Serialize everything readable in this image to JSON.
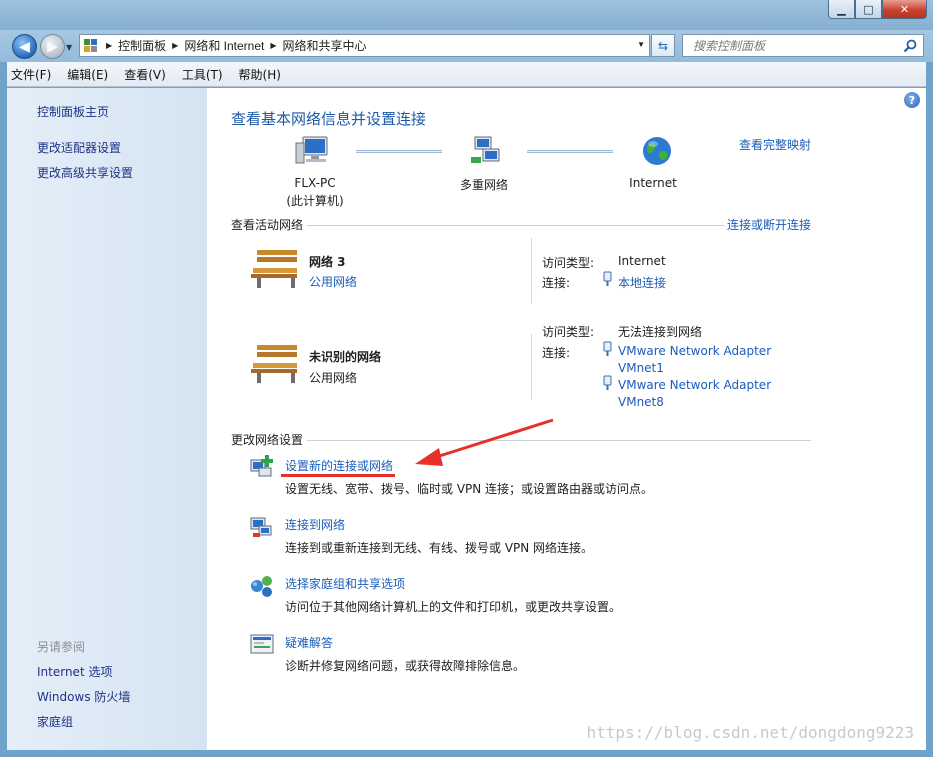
{
  "window": {
    "minimize_glyph": "▁",
    "maximize_glyph": "□",
    "close_glyph": "✕"
  },
  "address": {
    "crumbs": [
      "控制面板",
      "网络和 Internet",
      "网络和共享中心"
    ]
  },
  "search": {
    "placeholder": "搜索控制面板"
  },
  "menu": [
    "文件(F)",
    "编辑(E)",
    "查看(V)",
    "工具(T)",
    "帮助(H)"
  ],
  "sidebar": {
    "home": "控制面板主页",
    "adapter": "更改适配器设置",
    "sharing": "更改高级共享设置",
    "see_also": "另请参阅",
    "internet_options": "Internet 选项",
    "firewall": "Windows 防火墙",
    "homegroup": "家庭组"
  },
  "main": {
    "title": "查看基本网络信息并设置连接",
    "full_map": "查看完整映射",
    "map": {
      "pc_name": "FLX-PC",
      "pc_sub": "(此计算机)",
      "multi": "多重网络",
      "internet": "Internet"
    },
    "active_header": "查看活动网络",
    "connect_disconnect": "连接或断开连接",
    "net1": {
      "name": "网络  3",
      "type": "公用网络",
      "access_label": "访问类型:",
      "access_value": "Internet",
      "conn_label": "连接:",
      "conn_value": "本地连接"
    },
    "net2": {
      "name": "未识别的网络",
      "type": "公用网络",
      "access_label": "访问类型:",
      "access_value": "无法连接到网络",
      "conn_label": "连接:",
      "conn1_a": "VMware Network Adapter",
      "conn1_b": "VMnet1",
      "conn2_a": "VMware Network Adapter",
      "conn2_b": "VMnet8"
    },
    "change_header": "更改网络设置",
    "tasks": [
      {
        "title": "设置新的连接或网络",
        "desc": "设置无线、宽带、拨号、临时或 VPN 连接；或设置路由器或访问点。"
      },
      {
        "title": "连接到网络",
        "desc": "连接到或重新连接到无线、有线、拨号或 VPN 网络连接。"
      },
      {
        "title": "选择家庭组和共享选项",
        "desc": "访问位于其他网络计算机上的文件和打印机，或更改共享设置。"
      },
      {
        "title": "疑难解答",
        "desc": "诊断并修复网络问题，或获得故障排除信息。"
      }
    ]
  },
  "watermark": "https://blog.csdn.net/dongdong9223",
  "colors": {
    "link": "#1a5dbb",
    "annotation": "#e8302a"
  }
}
